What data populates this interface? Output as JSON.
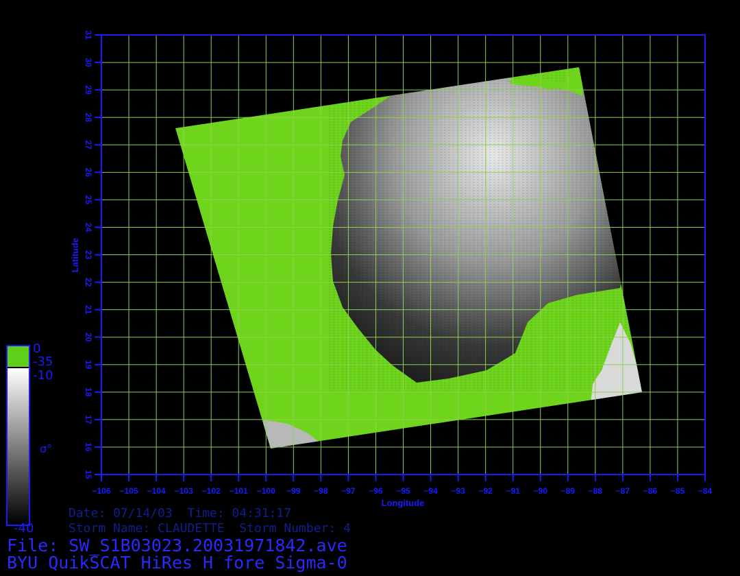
{
  "axes": {
    "xlabel": "Longitude",
    "ylabel": "Latitude",
    "lon_range": [
      -106,
      -84
    ],
    "lat_range": [
      15,
      31
    ],
    "lon_ticks": [
      -106,
      -105,
      -104,
      -103,
      -102,
      -101,
      -100,
      -99,
      -98,
      -97,
      -96,
      -95,
      -94,
      -93,
      -92,
      -91,
      -90,
      -89,
      -88,
      -87,
      -86,
      -85,
      -84
    ],
    "lat_ticks": [
      15,
      16,
      17,
      18,
      19,
      20,
      21,
      22,
      23,
      24,
      25,
      26,
      27,
      28,
      29,
      30,
      31
    ],
    "grid": true
  },
  "colorbar": {
    "land_top": "0",
    "land_bottom": "-35",
    "ocean_top": "-10",
    "ocean_bottom": "-40",
    "symbol": "σ°",
    "land_color": "#5fcf1a",
    "frame_color": "#1a1aff"
  },
  "info": {
    "date_line": "Date: 07/14/03  Time: 04:31:17",
    "storm_line": "Storm Name: CLAUDETTE  Storm Number: 4",
    "file_line": "File: SW_S1B03023.20031971842.ave",
    "title_line": "BYU QuikSCAT HiRes H fore Sigma-0"
  },
  "colors": {
    "axis": "#1a1aff",
    "grid": "#8fd14f",
    "land": "#6fd51c",
    "background": "#000000"
  }
}
